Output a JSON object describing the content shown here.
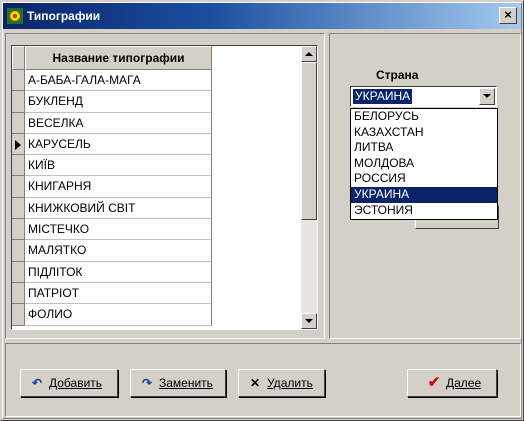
{
  "window": {
    "title": "Типографии",
    "close_label": "×"
  },
  "grid": {
    "column_header": "Название типографии",
    "current_row_index": 3,
    "rows": [
      "А-БАБА-ГАЛА-МАГА",
      "БУКЛЕНД",
      "ВЕСЕЛКА",
      "КАРУСЕЛЬ",
      "КИЇВ",
      "КНИГАРНЯ",
      "КНИЖКОВИЙ СВІТ",
      "МІСТЕЧКО",
      "МАЛЯТКО",
      "ПІДЛІТОК",
      "ПАТРІОТ",
      "ФОЛИО"
    ]
  },
  "country": {
    "label": "Страна",
    "selected": "УКРАИНА",
    "options": [
      "БЕЛОРУСЬ",
      "КАЗАХСТАН",
      "ЛИТВА",
      "МОЛДОВА",
      "РОССИЯ",
      "УКРАИНА",
      "ЭСТОНИЯ"
    ]
  },
  "buttons": {
    "add": "Добавить",
    "replace": "Заменить",
    "delete": "Удалить",
    "next": "Далее"
  },
  "icons": {
    "app": "app-icon",
    "add": "undo-arrow-icon",
    "replace": "redo-arrow-icon",
    "delete": "x-icon",
    "next": "checkmark-icon"
  },
  "colors": {
    "title_bar": "#0a246a",
    "selection": "#0a246a",
    "face": "#d4d0c8",
    "next_icon": "#d01010"
  }
}
